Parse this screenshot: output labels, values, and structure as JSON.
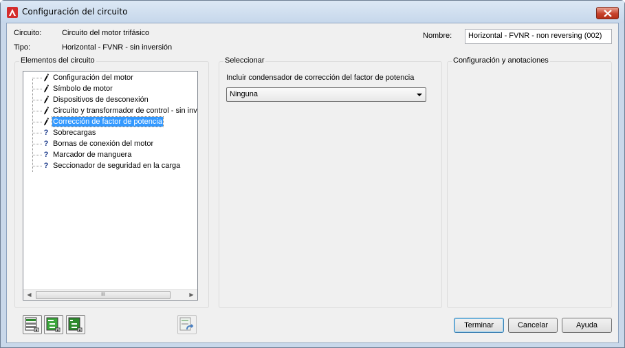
{
  "window": {
    "title": "Configuración del circuito"
  },
  "header": {
    "circuit_label": "Circuito:",
    "circuit_value": "Circuito del motor trifásico",
    "type_label": "Tipo:",
    "type_value": "Horizontal - FVNR - sin inversión",
    "name_label": "Nombre:",
    "name_value": "Horizontal - FVNR - non reversing (002)"
  },
  "elements_panel": {
    "title": "Elementos del circuito",
    "items": [
      {
        "label": "Configuración del motor",
        "icon": "pencil-icon",
        "state": "configured"
      },
      {
        "label": "Símbolo de motor",
        "icon": "pencil-icon",
        "state": "configured"
      },
      {
        "label": "Dispositivos de desconexión",
        "icon": "pencil-icon",
        "state": "configured"
      },
      {
        "label": "Circuito y transformador de control - sin inver",
        "icon": "pencil-icon",
        "state": "configured"
      },
      {
        "label": "Corrección de factor de potencia",
        "icon": "pencil-icon",
        "state": "selected"
      },
      {
        "label": "Sobrecargas",
        "icon": "question-icon",
        "state": "pending"
      },
      {
        "label": "Bornas de conexión del motor",
        "icon": "question-icon",
        "state": "pending"
      },
      {
        "label": "Marcador de manguera",
        "icon": "question-icon",
        "state": "pending"
      },
      {
        "label": "Seccionador de seguridad en la carga",
        "icon": "question-icon",
        "state": "pending"
      }
    ],
    "scroll_thumb_glyph": "III"
  },
  "select_panel": {
    "title": "Seleccionar",
    "field_label": "Incluir condensador de corrección del factor de potencia",
    "selected_option": "Ninguna"
  },
  "config_panel": {
    "title": "Configuración y anotaciones"
  },
  "footer": {
    "tool_icons": [
      "circuit-save-icon",
      "circuit-add-icon",
      "circuit-insert-icon",
      "circuit-reset-icon"
    ],
    "finish_label": "Terminar",
    "cancel_label": "Cancelar",
    "help_label": "Ayuda"
  },
  "colors": {
    "selection": "#3399ff",
    "pencil_icon": "#000000",
    "question_icon": "#1a3a8a",
    "close_button": "#c7432d",
    "frame": "#c9d8ea"
  }
}
